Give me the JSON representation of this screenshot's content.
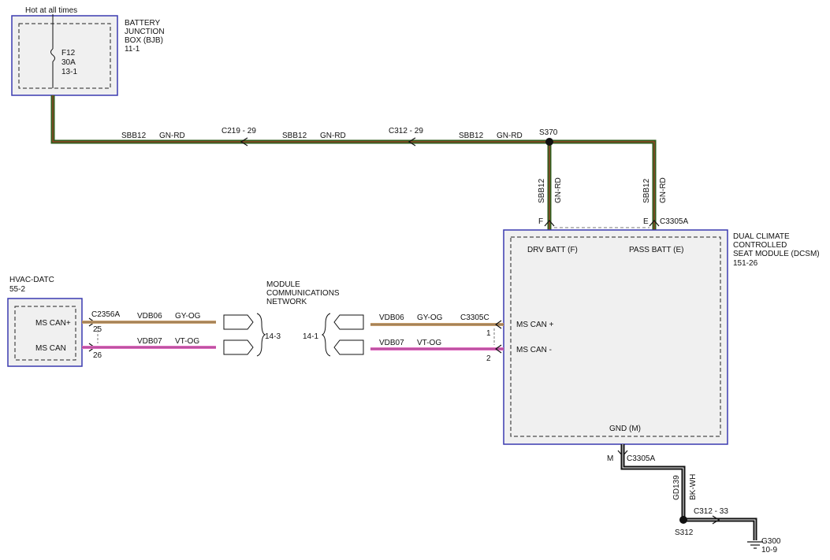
{
  "header": {
    "hot_label": "Hot at all times"
  },
  "bjb": {
    "name_lines": [
      "BATTERY",
      "JUNCTION",
      "BOX (BJB)"
    ],
    "ref": "11-1",
    "fuse": {
      "name": "F12",
      "rating": "30A",
      "ref": "13-1"
    }
  },
  "top_wire": {
    "segments": [
      {
        "circuit": "SBB12",
        "color": "GN-RD"
      },
      {
        "circuit": "SBB12",
        "color": "GN-RD"
      },
      {
        "circuit": "SBB12",
        "color": "GN-RD"
      }
    ],
    "connectors": [
      "C219 - 29",
      "C312 - 29"
    ],
    "splice": "S370"
  },
  "drop_wires": {
    "left": {
      "circuit": "SBB12",
      "color": "GN-RD",
      "pin": "F"
    },
    "right": {
      "circuit": "SBB12",
      "color": "GN-RD",
      "pin": "E"
    },
    "connector": "C3305A"
  },
  "dcsm": {
    "name_lines": [
      "DUAL CLIMATE",
      "CONTROLLED",
      "SEAT MODULE (DCSM)"
    ],
    "ref": "151-26",
    "drv_batt": "DRV BATT (F)",
    "pass_batt": "PASS BATT (E)",
    "ms_can_plus": "MS CAN +",
    "ms_can_minus": "MS CAN -",
    "gnd": "GND (M)",
    "can_connector": "C3305C",
    "pin_plus": "1",
    "pin_minus": "2"
  },
  "hvac": {
    "name": "HVAC-DATC",
    "ref": "55-2",
    "ms_can_plus": "MS CAN+",
    "ms_can_minus": "MS CAN",
    "connector": "C2356A",
    "pin_plus": "25",
    "pin_minus": "26"
  },
  "network": {
    "name_lines": [
      "MODULE",
      "COMMUNICATIONS",
      "NETWORK"
    ],
    "left_ref": "14-3",
    "right_ref": "14-1",
    "wires_left": [
      {
        "circuit": "VDB06",
        "color": "GY-OG"
      },
      {
        "circuit": "VDB07",
        "color": "VT-OG"
      }
    ],
    "wires_right": [
      {
        "circuit": "VDB06",
        "color": "GY-OG"
      },
      {
        "circuit": "VDB07",
        "color": "VT-OG"
      }
    ]
  },
  "ground": {
    "pin": "M",
    "connector": "C3305A",
    "circuit": "GD139",
    "color": "BK-WH",
    "splice": "S312",
    "connector2": "C312 - 33",
    "ground_point": "G300",
    "ground_ref": "10-9"
  },
  "colors": {
    "green": "#2f5d1c",
    "red": "#c0392b",
    "tan": "#c8a070",
    "pink": "#e06cc0",
    "module_border": "#3a3ab0",
    "module_fill": "#f0f0f0"
  }
}
